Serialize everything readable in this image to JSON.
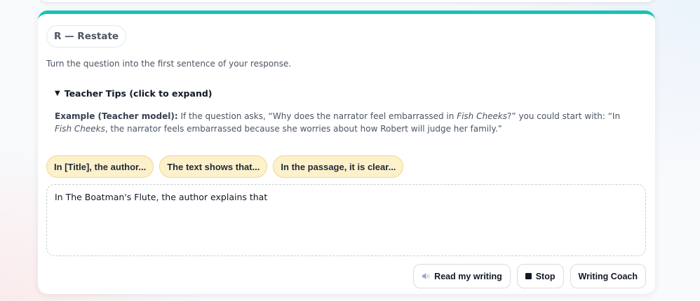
{
  "step": {
    "chip_label": "R — Restate",
    "instruction": "Turn the question into the first sentence of your response."
  },
  "tips": {
    "caret": "▼",
    "summary": "Teacher Tips (click to expand)",
    "example_label": "Example (Teacher model):",
    "text_1": " If the question asks, “Why does the narrator feel embarrassed in ",
    "title_1": "Fish Cheeks",
    "text_2": "?” you could start with: “In ",
    "title_2": "Fish Cheeks",
    "text_3": ", the narrator feels embarrassed because she worries about how Robert will judge her family.”"
  },
  "starters": [
    {
      "label": "In [Title], the author..."
    },
    {
      "label": "The text shows that..."
    },
    {
      "label": "In the passage, it is clear..."
    }
  ],
  "editor": {
    "value": "In The Boatman's Flute, the author explains that"
  },
  "actions": {
    "read_label": "Read my writing",
    "stop_label": "Stop",
    "coach_label": "Writing Coach",
    "read_icon": "speaker-icon",
    "stop_icon": "stop-icon"
  },
  "colors": {
    "accent": "#17c3b2",
    "starter_bg": "#fdf1cc",
    "starter_border": "#f2d694"
  }
}
